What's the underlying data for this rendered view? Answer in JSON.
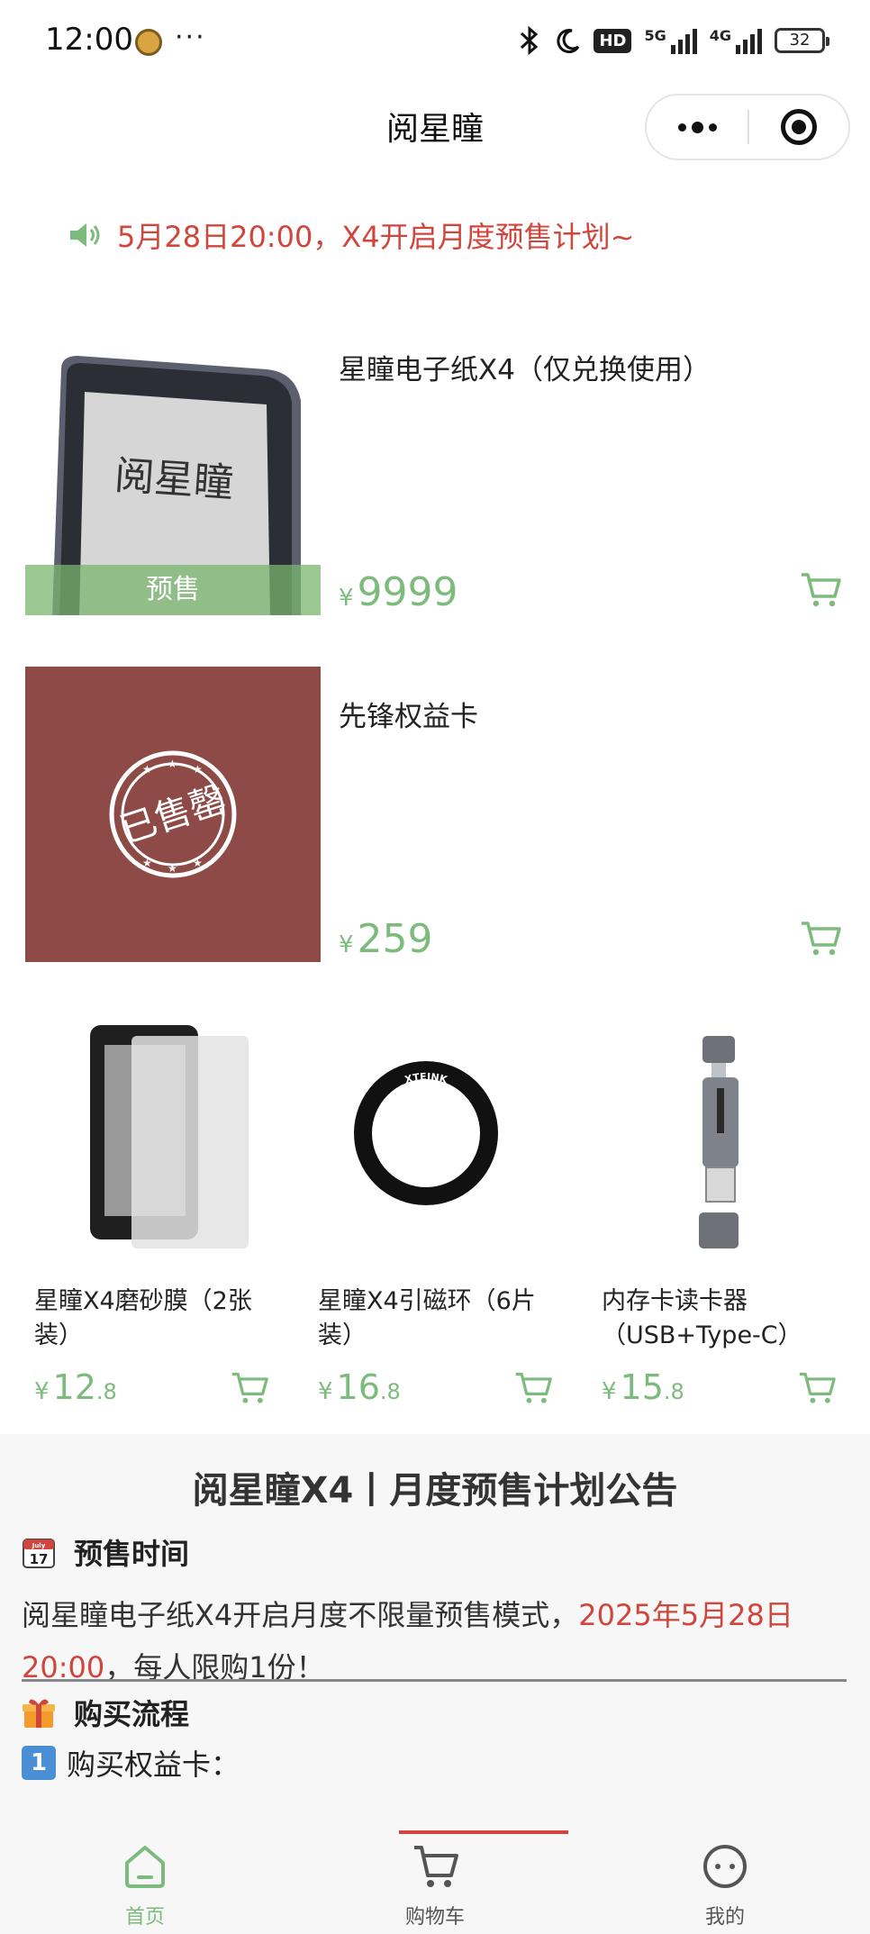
{
  "status_bar": {
    "time": "12:00",
    "more": "···",
    "hd": "HD",
    "net1": "5G",
    "net2": "4G",
    "battery": "32",
    "icons": [
      "bluetooth-icon",
      "moon-icon",
      "hd-icon",
      "signal-5g-icon",
      "signal-4g-icon",
      "battery-icon"
    ]
  },
  "nav": {
    "title": "阅星瞳"
  },
  "notice": {
    "text": "5月28日20:00，X4开启月度预售计划~",
    "icon": "speaker-icon"
  },
  "products": [
    {
      "name": "星瞳电子纸X4（仅兑换使用）",
      "currency": "¥",
      "price": "9999",
      "badge": "预售",
      "screen_text": "阅星瞳"
    },
    {
      "name": "先锋权益卡",
      "currency": "¥",
      "price": "259",
      "stamp_text": "已售罄"
    }
  ],
  "accessories": [
    {
      "name": "星瞳X4磨砂膜（2张装）",
      "currency": "¥",
      "price_int": "12",
      "price_dec": ".8"
    },
    {
      "name": "星瞳X4引磁环（6片装）",
      "currency": "¥",
      "price_int": "16",
      "price_dec": ".8",
      "ring_text": "XTEINK"
    },
    {
      "name": "内存卡读卡器（USB+Type-C）",
      "currency": "¥",
      "price_int": "15",
      "price_dec": ".8"
    }
  ],
  "announcement": {
    "title": "阅星瞳X4丨月度预售计划公告",
    "section1_title": "预售时间",
    "calendar_icon_text": "17",
    "calendar_month": "July",
    "body_pre": "阅星瞳电子纸X4开启月度不限量预售模式，",
    "body_highlight": "2025年5月28日20:00",
    "body_post": "，每人限购1份！",
    "section2_title": "购买流程",
    "step1_num": "1",
    "step1_text": "购买权益卡："
  },
  "tabbar": {
    "home": "首页",
    "cart": "购物车",
    "mine": "我的"
  },
  "colors": {
    "accent_green": "#7dbb7d",
    "highlight_red": "#d0453c",
    "card_maroon": "#8d4a46"
  }
}
